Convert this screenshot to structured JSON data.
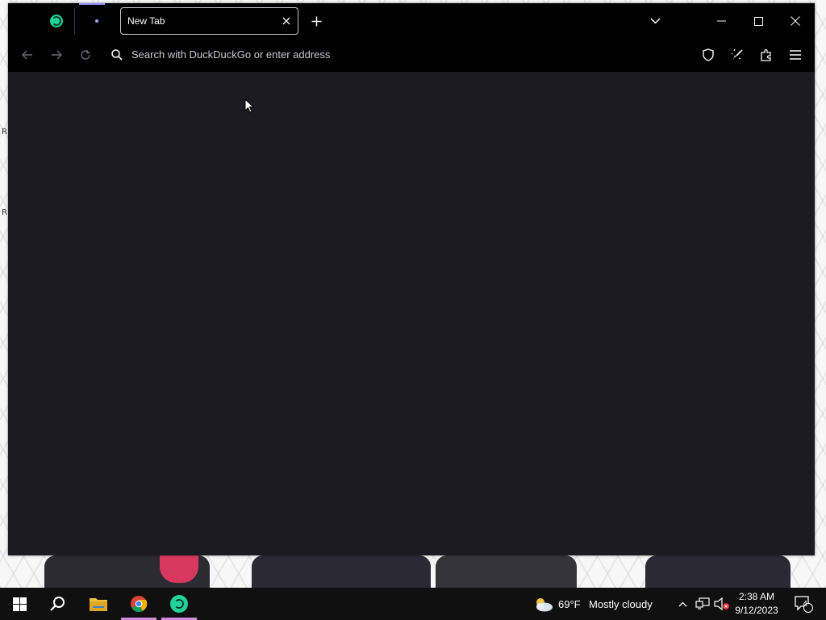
{
  "browser": {
    "tab": {
      "title": "New Tab"
    },
    "urlbar": {
      "placeholder": "Search with DuckDuckGo or enter address"
    },
    "icons": [
      "back-icon",
      "forward-icon",
      "reload-icon",
      "search-icon",
      "shield-icon",
      "broom-icon",
      "extensions-icon",
      "menu-icon"
    ]
  },
  "taskbar": {
    "weather": {
      "temp": "69°F",
      "condition": "Mostly cloudy"
    },
    "clock": {
      "time": "2:38 AM",
      "date": "9/12/2023"
    },
    "notifications": {
      "count": "4"
    }
  },
  "colors": {
    "chrome": "#000000",
    "page": "#1c1b22",
    "taskbar": "#101010",
    "accent": "#d08cd8",
    "tor_green": "#1fd39a"
  }
}
